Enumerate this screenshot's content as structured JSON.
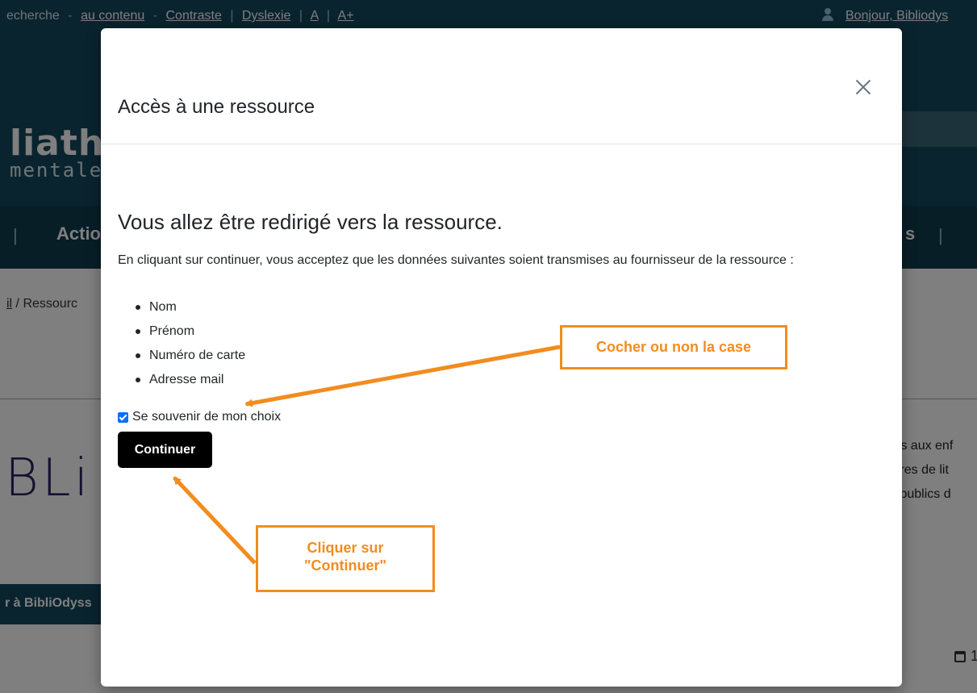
{
  "topbar": {
    "links": [
      "echerche",
      "au contenu",
      "Contraste",
      "Dyslexie",
      "A",
      "A+"
    ],
    "separators": [
      "-",
      "-",
      "|",
      "|",
      "|"
    ],
    "user_text": "Bonjour, Bibliodys"
  },
  "header": {
    "logo_big": "liath",
    "logo_small": "mentale"
  },
  "navbar": {
    "items": [
      "|",
      "Actio",
      "s",
      "|"
    ]
  },
  "breadcrumb": {
    "home": "il",
    "separator": " / ",
    "current": "Ressourc"
  },
  "background": {
    "bibli_text": "BLi",
    "side_lines": [
      "tés aux enf",
      "titres de lit",
      "s publics d"
    ],
    "dark_button": "r à BibliOdyss",
    "date_text": "1"
  },
  "modal": {
    "title": "Accès à une ressource",
    "heading": "Vous allez être redirigé vers la ressource.",
    "intro": "En cliquant sur continuer, vous acceptez que les données suivantes soient transmises au fournisseur de la ressource :",
    "fields": [
      "Nom",
      "Prénom",
      "Numéro de carte",
      "Adresse mail"
    ],
    "remember_label": "Se souvenir de mon choix",
    "remember_checked": true,
    "continue_label": "Continuer"
  },
  "annotations": {
    "check_note": "Cocher ou non la case",
    "continue_note_line1": "Cliquer sur",
    "continue_note_line2": "\"Continuer\"",
    "color": "#f28c1e"
  },
  "colors": {
    "header_bg": "#12485e",
    "nav_bg": "#103c4e",
    "button_bg": "#000000",
    "checkbox": "#0d6efd"
  }
}
